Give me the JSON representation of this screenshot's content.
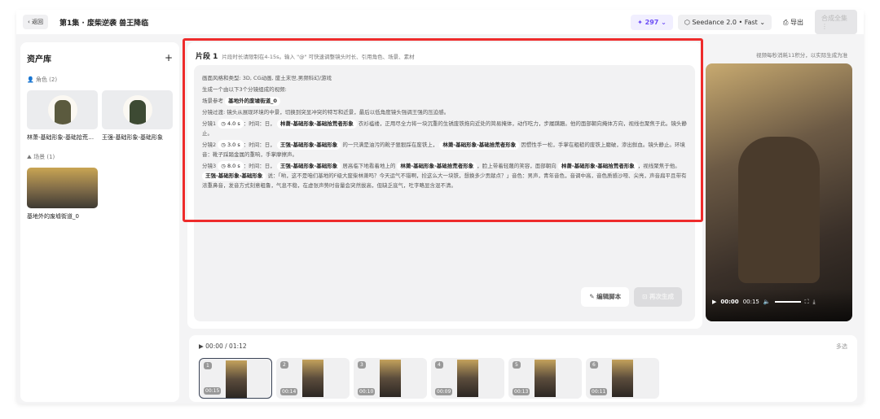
{
  "topbar": {
    "back": "‹ 返回",
    "title": "第1集 · 废柴逆袭 兽王降临",
    "credits": "✦ 297 ⌄",
    "model": "⬡ Seedance 2.0 • Fast ⌄",
    "export": "⎙ 导出",
    "compose": "合成全集 ⋮"
  },
  "assets": {
    "title": "资产库",
    "add": "+",
    "roles_label": "角色 (2)",
    "roles": [
      "林萧-基础形象-基础拾荒者...",
      "王强-基础形象-基础形象"
    ],
    "scenes_label": "场景 (1)",
    "scenes": [
      "基地外的废墟街道_0"
    ]
  },
  "segment": {
    "title": "片段 1",
    "hint": "片段时长请限制在4-15s。输入 \"@\" 可快速调整镜头时长、引用角色、场景、素材",
    "cost_note": "视频每秒消耗11积分，以实际生成为准",
    "lines": {
      "style": "画面风格和类型: 3D, CG动画, 废土末世,男频科幻/游戏",
      "intro": "生成一个由以下3个分镜组成的视频:",
      "scene_label": "场景参考",
      "scene_chip": "基地外的废墟街道_0",
      "transition": "分镜过渡: 镜头从展现环境的中景，切换到突显冲突的特写和近景，最后以低角度镜头强调王强的压迫感。",
      "s1_label": "分镜1",
      "s1_dur": "◷ 4.0 s",
      "s1_a": "：时间：日，",
      "s1_chip": "林萧-基础形象-基础拾荒者形象",
      "s1_b": "衣衫褴褛，正用尽全力将一块沉重的生锈废铁拖向近处的简易掩体，动作吃力，步履蹒跚。他的面部朝向掩体方向，视线也聚焦于此。镜头静止。",
      "s2_label": "分镜2",
      "s2_dur": "◷ 3.0 s",
      "s2_a": "：时间：日，",
      "s2_chip1": "王强-基础形象-基础形象",
      "s2_b": "的一只满是油污的靴子狠狠踩在废铁上，",
      "s2_chip2": "林萧-基础形象-基础拾荒者形象",
      "s2_c": "因惯性手一松，手掌在粗糙的废铁上磨破，渗出鲜血。镜头静止。环境音：靴子踩踏金属的重响，手掌摩擦声。",
      "s3_label": "分镜3",
      "s3_dur": "◷ 8.0 s",
      "s3_a": "：时间：日，",
      "s3_chip1": "王强-基础形象-基础形象",
      "s3_b": "居高临下地看着地上的",
      "s3_chip2": "林萧-基础形象-基础拾荒者形象",
      "s3_c": "，脸上带着轻蔑的笑容，面部朝向",
      "s3_chip3": "林萧-基础形象-基础拾荒者形象",
      "s3_d": "，视线聚焦于他。",
      "s3_chip4": "王强-基础形象-基础形象",
      "s3_e": "说：「哟，这不是咱们基地的F级大废柴林萧吗？今天运气不错啊，捡这么大一块铁，想换多少贡献点？」音色：男声，青年音色，音调中高，音色质感沙哑、尖亮，声音扁平且带有浓重鼻音，发音方式刻意粗鲁，气息不稳，在虚张声势时音量会突然拔高，但缺乏底气，吐字略显含混不清。"
    },
    "edit_btn": "✎ 编辑脚本",
    "regen_btn": "⊡ 再次生成"
  },
  "video": {
    "play": "▶",
    "current": "00:00",
    "total": "00:15",
    "volume": "🔈",
    "fullscreen": "⛶",
    "download": "⤓",
    "volume_level": 0.6
  },
  "timeline": {
    "time": "▶   00:00 / 01:12",
    "multi": "多选",
    "clips": [
      {
        "n": "1",
        "d": "00:15"
      },
      {
        "n": "2",
        "d": "00:14"
      },
      {
        "n": "3",
        "d": "00:10"
      },
      {
        "n": "4",
        "d": "00:09"
      },
      {
        "n": "5",
        "d": "00:13"
      },
      {
        "n": "6",
        "d": "00:11"
      }
    ]
  }
}
